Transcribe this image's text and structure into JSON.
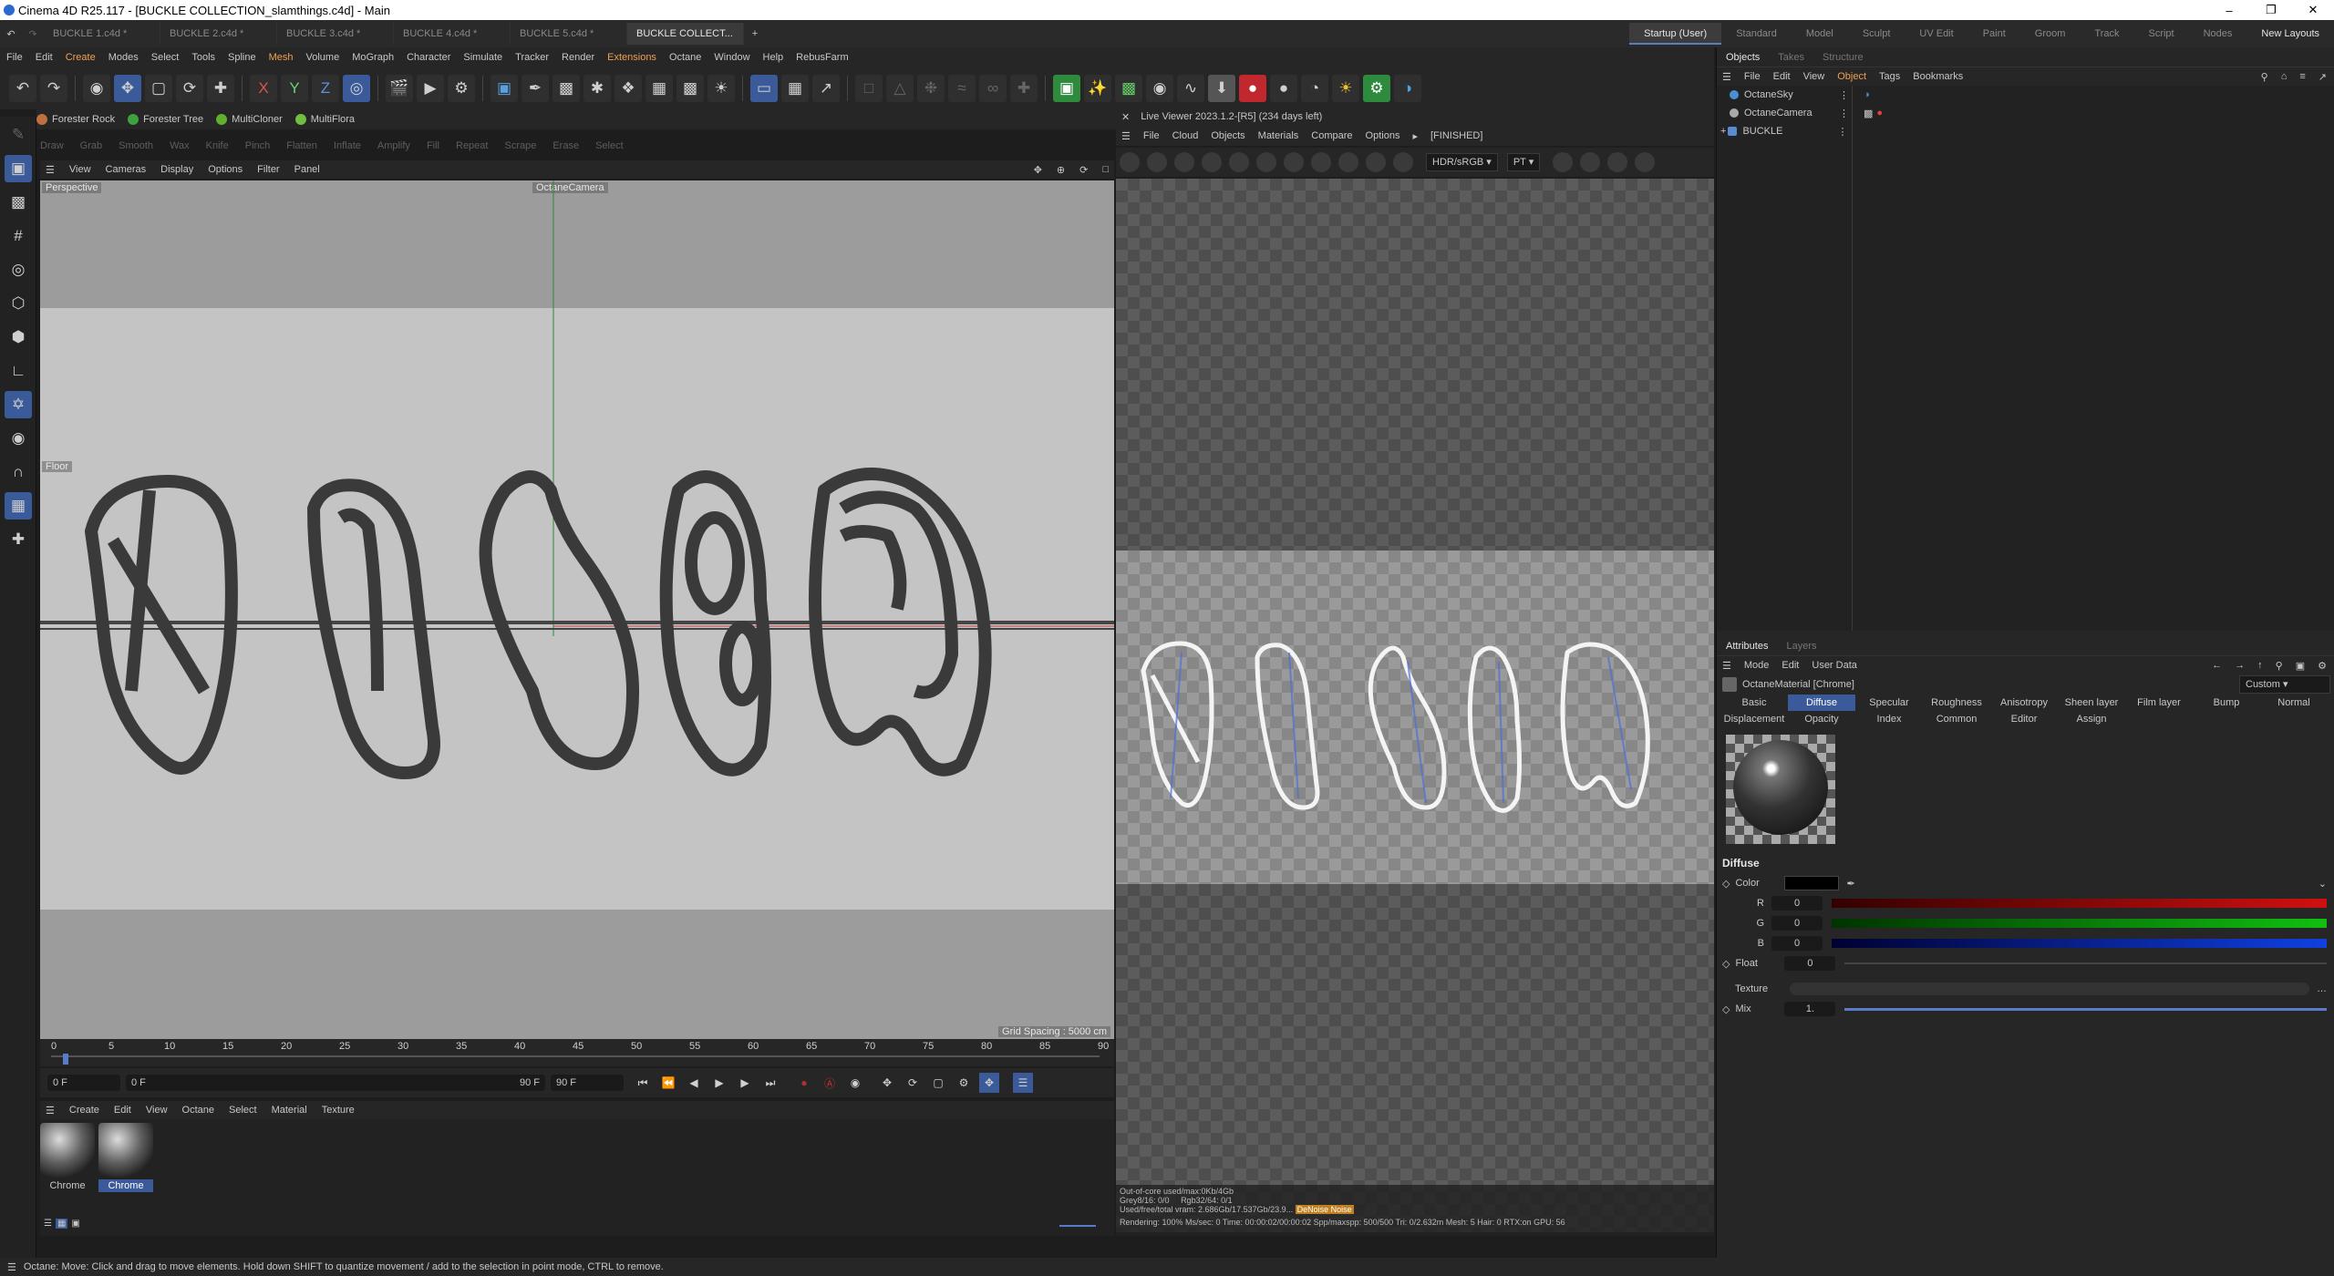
{
  "window": {
    "title": "Cinema 4D R25.117 - [BUCKLE COLLECTION_slamthings.c4d] - Main"
  },
  "doc_tabs": [
    "BUCKLE 1.c4d *",
    "BUCKLE 2.c4d *",
    "BUCKLE 3.c4d *",
    "BUCKLE 4.c4d *",
    "BUCKLE 5.c4d *",
    "BUCKLE COLLECT..."
  ],
  "layouts": [
    "Startup (User)",
    "Standard",
    "Model",
    "Sculpt",
    "UV Edit",
    "Paint",
    "Groom",
    "Track",
    "Script",
    "Nodes"
  ],
  "new_layouts": "New Layouts",
  "menu": [
    "File",
    "Edit",
    "Create",
    "Modes",
    "Select",
    "Tools",
    "Spline",
    "Mesh",
    "Volume",
    "MoGraph",
    "Character",
    "Simulate",
    "Tracker",
    "Render",
    "Extensions",
    "Octane",
    "Window",
    "Help",
    "RebusFarm"
  ],
  "plugins": [
    "Forester Rock",
    "Forester Tree",
    "MultiCloner",
    "MultiFlora"
  ],
  "sculpt_tools": [
    "Draw",
    "Grab",
    "Smooth",
    "Wax",
    "Knife",
    "Pinch",
    "Flatten",
    "Inflate",
    "Amplify",
    "Fill",
    "Repeat",
    "Scrape",
    "Erase",
    "Select"
  ],
  "viewport": {
    "menu": [
      "View",
      "Cameras",
      "Display",
      "Options",
      "Filter",
      "Panel"
    ],
    "label": "Perspective",
    "camera": "OctaneCamera",
    "floor": "Floor",
    "grid_spacing": "Grid Spacing : 5000 cm"
  },
  "timeline": {
    "ticks": [
      "0",
      "5",
      "10",
      "15",
      "20",
      "25",
      "30",
      "35",
      "40",
      "45",
      "50",
      "55",
      "60",
      "65",
      "70",
      "75",
      "80",
      "85",
      "90"
    ],
    "start": "0 F",
    "current": "0 F",
    "end": "90 F",
    "end2": "90 F"
  },
  "material_manager": {
    "menu": [
      "Create",
      "Edit",
      "View",
      "Octane",
      "Select",
      "Material",
      "Texture"
    ],
    "materials": [
      "Chrome",
      "Chrome"
    ]
  },
  "live_viewer": {
    "title": "Live Viewer 2023.1.2-[R5] (234 days left)",
    "menu": [
      "File",
      "Cloud",
      "Objects",
      "Materials",
      "Compare",
      "Options"
    ],
    "status": "[FINISHED]",
    "color_space": "HDR/sRGB",
    "kernel": "PT",
    "stats": [
      "Out-of-core used/max:0Kb/4Gb",
      "Grey8/16: 0/0",
      "Rgb32/64: 0/1",
      "Used/free/total vram: 2.686Gb/17.537Gb/23.9...",
      "DeNoise Noise",
      "Rendering: 100% Ms/sec: 0  Time: 00:00:02/00:00:02  Spp/maxspp: 500/500  Tri: 0/2.632m  Mesh: 5  Hair: 0  RTX:on  GPU: 56"
    ]
  },
  "objects_panel": {
    "tabs": [
      "Objects",
      "Takes",
      "Structure"
    ],
    "menu": [
      "File",
      "Edit",
      "View",
      "Object",
      "Tags",
      "Bookmarks"
    ],
    "items": [
      "OctaneSky",
      "OctaneCamera",
      "BUCKLE"
    ]
  },
  "attributes": {
    "tabs": [
      "Attributes",
      "Layers"
    ],
    "menu": [
      "Mode",
      "Edit",
      "User Data"
    ],
    "material_name": "OctaneMaterial [Chrome]",
    "preset": "Custom",
    "channel_tabs": [
      "Basic",
      "Diffuse",
      "Specular",
      "Roughness",
      "Anisotropy",
      "Sheen layer",
      "Film layer",
      "Bump",
      "Normal",
      "Displacement",
      "Opacity",
      "Index",
      "Common",
      "Editor",
      "Assign"
    ],
    "section": "Diffuse",
    "color_label": "Color",
    "r": "0",
    "g": "0",
    "b": "0",
    "float_label": "Float",
    "float_value": "0",
    "texture_label": "Texture",
    "mix_label": "Mix",
    "mix_value": "1."
  },
  "status": "Octane:    Move: Click and drag to move elements. Hold down SHIFT to quantize movement / add to the selection in point mode, CTRL to remove.",
  "colors": {
    "accent": "#3a5a9a",
    "highlight": "#f0a050",
    "red": "#d01010",
    "green": "#10c010",
    "blue": "#1040e0"
  }
}
